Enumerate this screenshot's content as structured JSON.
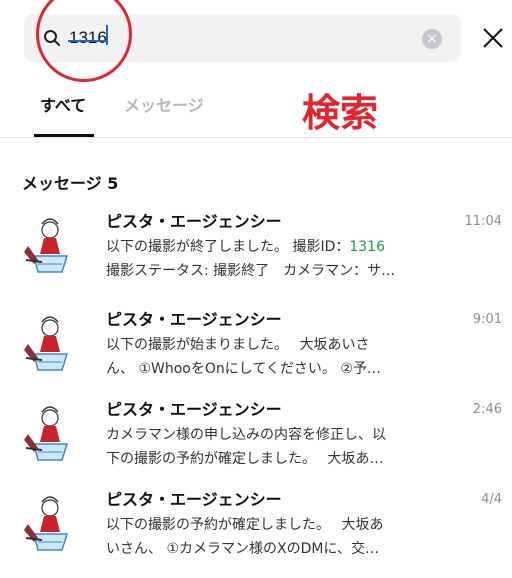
{
  "search": {
    "query": "1316"
  },
  "tabs": [
    {
      "label": "すべて",
      "active": true
    },
    {
      "label": "メッセージ",
      "active": false
    }
  ],
  "overlay_label": "検索",
  "section": {
    "title": "メッセージ 5"
  },
  "results": [
    {
      "name": "ピスタ・エージェンシー",
      "time": "11:04",
      "line1_text": "以下の撮影が終了しました。 撮影ID：",
      "line1_highlight": "1316",
      "line2": "撮影ステータス: 撮影終了　カメラマン：サ…"
    },
    {
      "name": "ピスタ・エージェンシー",
      "time": "9:01",
      "line1_text": "以下の撮影が始まりました。　 大坂あいさ",
      "line1_highlight": "",
      "line2": "ん、 ①WhooをOnにしてください。 ②予…"
    },
    {
      "name": "ピスタ・エージェンシー",
      "time": "2:46",
      "line1_text": "カメラマン様の申し込みの内容を修正し、以",
      "line1_highlight": "",
      "line2": "下の撮影の予約が確定しました。　 大坂あ…"
    },
    {
      "name": "ピスタ・エージェンシー",
      "time": "4/4",
      "line1_text": "以下の撮影の予約が確定しました。　 大坂あ",
      "line1_highlight": "",
      "line2": "いさん、 ①カメラマン様のXのDMに、交…"
    }
  ],
  "colors": {
    "accent": "#e3252f",
    "highlight": "#1f9a3f",
    "caret": "#1e63d6"
  },
  "icons": {
    "search": "search-icon",
    "clear": "clear-icon",
    "close": "close-icon",
    "avatar": "character-avatar"
  }
}
